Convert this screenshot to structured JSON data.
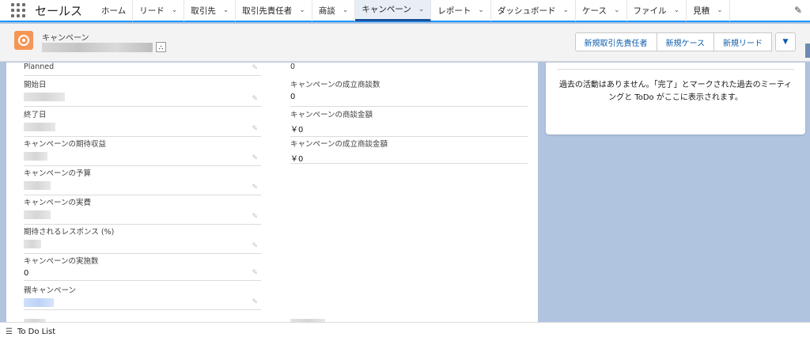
{
  "nav": {
    "app_name": "セールス",
    "items": [
      {
        "label": "ホーム"
      },
      {
        "label": "リード"
      },
      {
        "label": "取引先"
      },
      {
        "label": "取引先責任者"
      },
      {
        "label": "商談"
      },
      {
        "label": "キャンペーン"
      },
      {
        "label": "レポート"
      },
      {
        "label": "ダッシュボード"
      },
      {
        "label": "ケース"
      },
      {
        "label": "ファイル"
      },
      {
        "label": "見積"
      }
    ],
    "active_item": "キャンペーン"
  },
  "record": {
    "type_label": "キャンペーン",
    "actions": [
      "新規取引先責任者",
      "新規ケース",
      "新規リード"
    ]
  },
  "details": {
    "left": [
      {
        "label": "Planned",
        "value": ""
      },
      {
        "label": "開始日",
        "value": ""
      },
      {
        "label": "終了日",
        "value": ""
      },
      {
        "label": "キャンペーンの期待収益",
        "value": ""
      },
      {
        "label": "キャンペーンの予算",
        "value": ""
      },
      {
        "label": "キャンペーンの実費",
        "value": ""
      },
      {
        "label": "期待されるレスポンス (%)",
        "value": ""
      },
      {
        "label": "キャンペーンの実施数",
        "value": "0"
      },
      {
        "label": "親キャンペーン",
        "value": ""
      }
    ],
    "right": [
      {
        "label": "",
        "value": "0"
      },
      {
        "label": "キャンペーンの成立商談数",
        "value": "0"
      },
      {
        "label": "キャンペーンの商談金額",
        "value": "￥0"
      },
      {
        "label": "キャンペーンの成立商談金額",
        "value": "￥0"
      }
    ]
  },
  "activity": {
    "empty_message": "過去の活動はありません。「完了」とマークされた過去のミーティングと ToDo がここに表示されます。"
  },
  "utility": {
    "todo_label": "To Do List"
  },
  "colors": {
    "accent": "#1b96ff",
    "campaign_icon": "#f49756",
    "background": "#b0c4df",
    "link": "#0b5cab"
  }
}
